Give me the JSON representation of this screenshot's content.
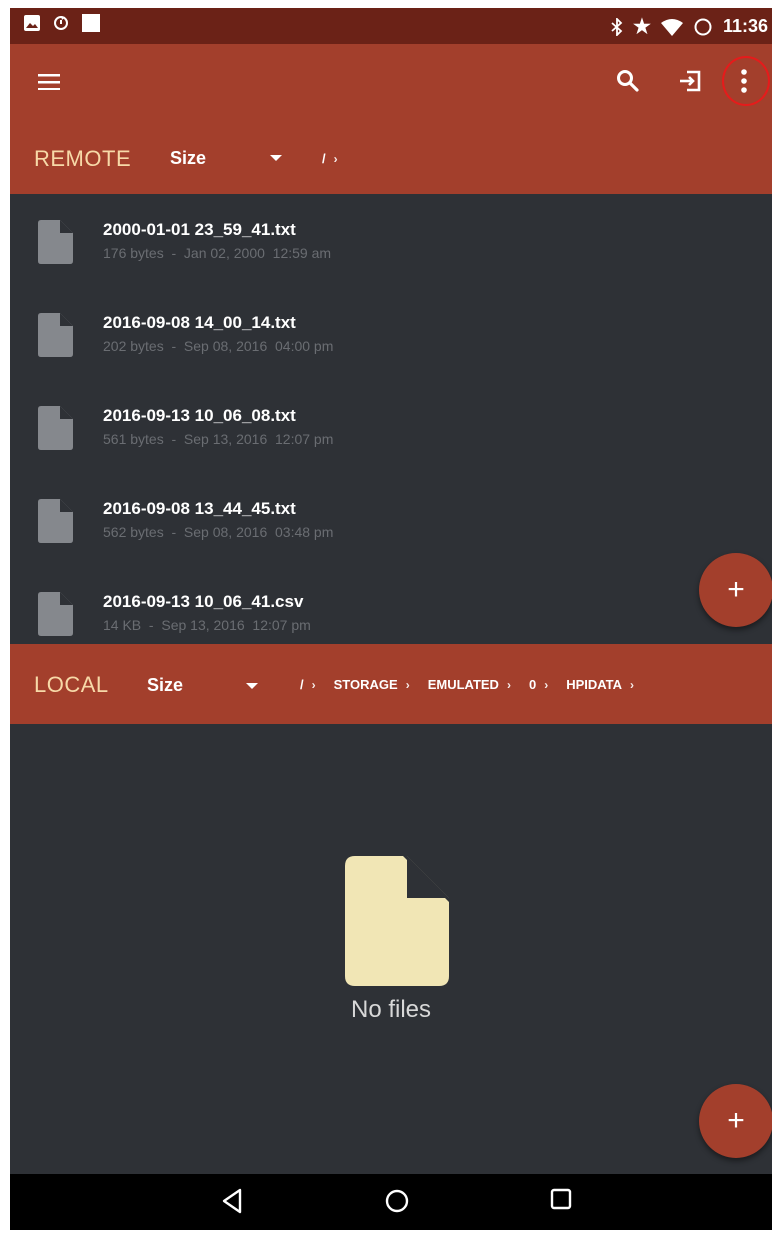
{
  "status_bar": {
    "time": "11:36",
    "icons_left": [
      "image-icon",
      "sync-icon",
      "square-notification-icon"
    ],
    "icons_right": [
      "bluetooth-icon",
      "star-icon",
      "wifi-icon",
      "battery-icon"
    ]
  },
  "app_bar": {
    "icons": [
      "menu-icon",
      "search-icon",
      "exit-icon",
      "more-vert-icon"
    ]
  },
  "remote": {
    "label": "REMOTE",
    "sort_label": "Size",
    "breadcrumbs": [
      "/"
    ],
    "files": [
      {
        "name": "2000-01-01 23_59_41.txt",
        "meta": "176 bytes  -  Jan 02, 2000  12:59 am"
      },
      {
        "name": "2016-09-08 14_00_14.txt",
        "meta": "202 bytes  -  Sep 08, 2016  04:00 pm"
      },
      {
        "name": "2016-09-13 10_06_08.txt",
        "meta": "561 bytes  -  Sep 13, 2016  12:07 pm"
      },
      {
        "name": "2016-09-08 13_44_45.txt",
        "meta": "562 bytes  -  Sep 08, 2016  03:48 pm"
      },
      {
        "name": "2016-09-13 10_06_41.csv",
        "meta": "14 KB  -  Sep 13, 2016  12:07 pm"
      }
    ],
    "fab": "+"
  },
  "local": {
    "label": "LOCAL",
    "sort_label": "Size",
    "breadcrumbs": [
      "/",
      "STORAGE",
      "EMULATED",
      "0",
      "HPIDATA"
    ],
    "empty_text": "No files",
    "fab": "+"
  },
  "colors": {
    "status_bar": "#6b2217",
    "app_bar": "#a33f2c",
    "pane_label": "#f7d9a8",
    "background": "#2e3136",
    "empty_file_icon": "#f1e6b5",
    "highlight": "#e61b1b"
  },
  "nav_bar": {
    "buttons": [
      "back-icon",
      "home-icon",
      "recents-icon"
    ]
  }
}
